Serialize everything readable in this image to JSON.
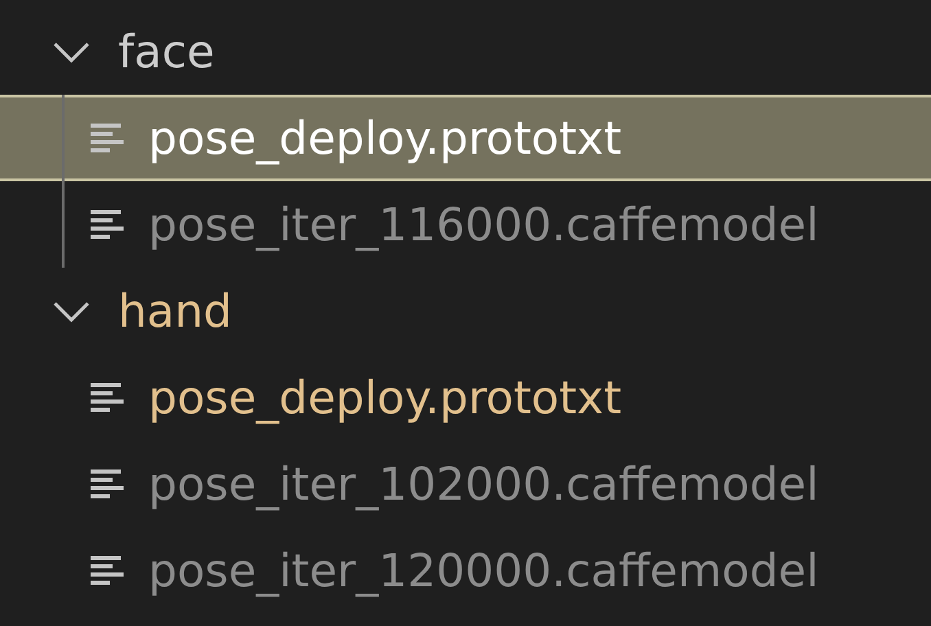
{
  "tree": [
    {
      "name": "face",
      "expanded": true,
      "color": "#cccccc",
      "children": [
        {
          "name": "pose_deploy.prototxt",
          "selected": true,
          "color": "#ffffff"
        },
        {
          "name": "pose_iter_116000.caffemodel",
          "selected": false,
          "color": "#8c8c8c"
        }
      ]
    },
    {
      "name": "hand",
      "expanded": true,
      "color": "#e2c08d",
      "children": [
        {
          "name": "pose_deploy.prototxt",
          "selected": false,
          "color": "#e2c08d"
        },
        {
          "name": "pose_iter_102000.caffemodel",
          "selected": false,
          "color": "#8c8c8c"
        },
        {
          "name": "pose_iter_120000.caffemodel",
          "selected": false,
          "color": "#8c8c8c"
        }
      ]
    }
  ]
}
